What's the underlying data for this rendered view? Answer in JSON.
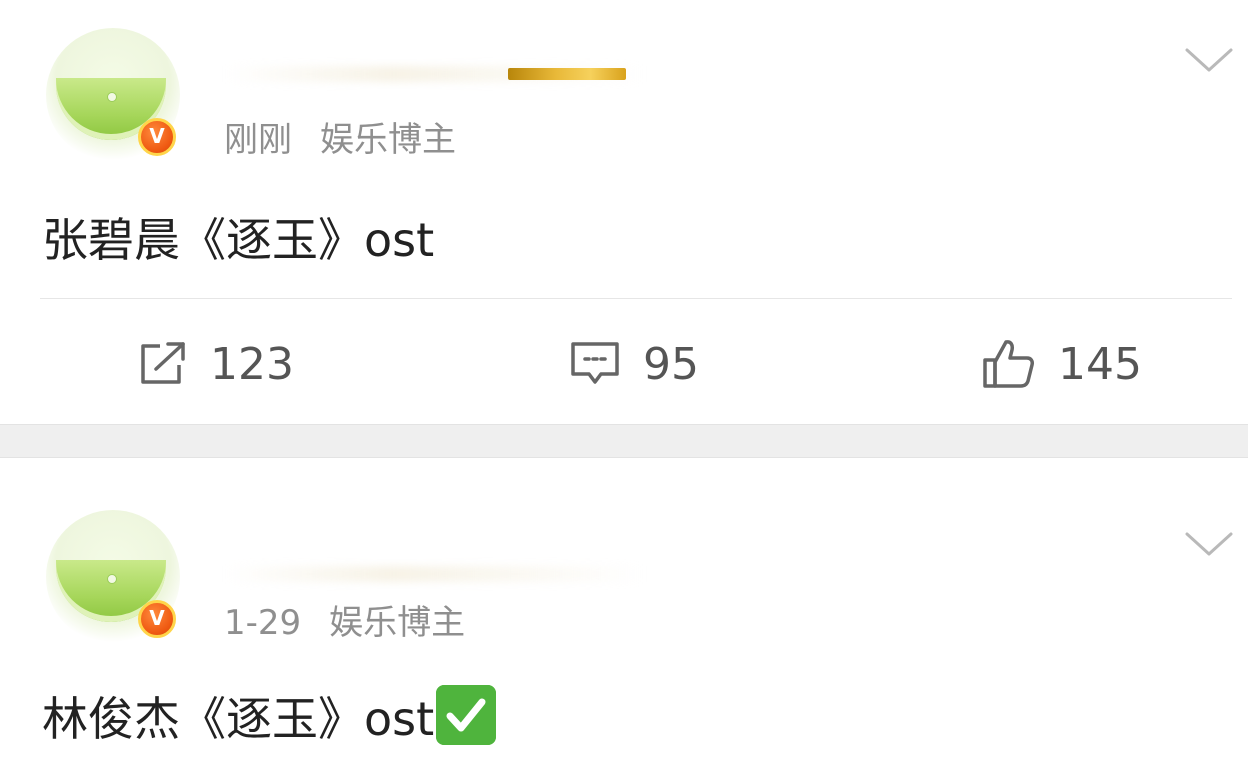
{
  "posts": [
    {
      "time": "刚刚",
      "category": "娱乐博主",
      "badge": "V",
      "content": "张碧晨《逐玉》ost",
      "actions": {
        "repost_count": "123",
        "comment_count": "95",
        "like_count": "145"
      },
      "icons": {
        "avatar": "melon-avatar",
        "verified": "verified-v-icon",
        "more": "chevron-down-icon",
        "repost": "share-icon",
        "comment": "comment-icon",
        "like": "thumbs-up-icon"
      }
    },
    {
      "time": "1-29",
      "category": "娱乐博主",
      "badge": "V",
      "content": "林俊杰《逐玉》ost",
      "trailing_emoji": "✅",
      "icons": {
        "avatar": "melon-avatar",
        "verified": "verified-v-icon",
        "more": "chevron-down-icon",
        "check": "check-mark-icon"
      }
    }
  ],
  "colors": {
    "verified_orange": "#ef5a12",
    "verified_ring": "#ffd54a",
    "meta_gray": "#8f8f8f",
    "text": "#222222",
    "action_gray": "#555555",
    "check_green": "#4fb43d"
  }
}
